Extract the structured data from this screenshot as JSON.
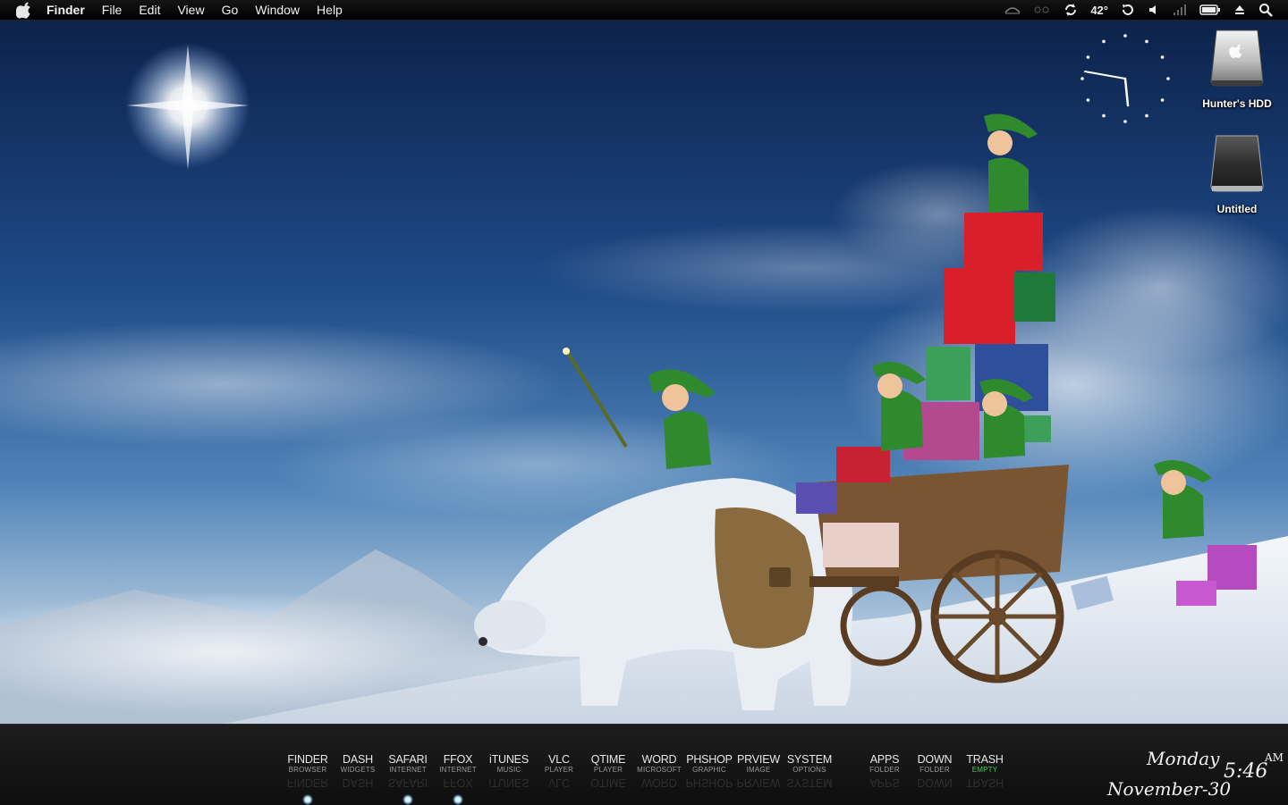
{
  "menubar": {
    "active_app": "Finder",
    "items": [
      "File",
      "Edit",
      "View",
      "Go",
      "Window",
      "Help"
    ],
    "status": {
      "temperature": "42°",
      "icons": [
        "network-icon",
        "bluetooth-icon",
        "sync-icon",
        "time-machine-icon",
        "volume-icon",
        "wifi-signal-icon",
        "battery-icon",
        "eject-icon",
        "spotlight-icon"
      ]
    }
  },
  "desktop": {
    "icons": [
      {
        "label": "Hunter's HDD",
        "icon": "hard-drive-icon"
      },
      {
        "label": "Untitled",
        "icon": "external-drive-icon"
      }
    ]
  },
  "dock": {
    "items": [
      {
        "title": "FINDER",
        "subtitle": "BROWSER",
        "running": true
      },
      {
        "title": "DASH",
        "subtitle": "WIDGETS",
        "running": false
      },
      {
        "title": "SAFARI",
        "subtitle": "INTERNET",
        "running": true
      },
      {
        "title": "FFOX",
        "subtitle": "INTERNET",
        "running": true
      },
      {
        "title": "iTUNES",
        "subtitle": "MUSIC",
        "running": false
      },
      {
        "title": "VLC",
        "subtitle": "PLAYER",
        "running": false
      },
      {
        "title": "QTIME",
        "subtitle": "PLAYER",
        "running": false
      },
      {
        "title": "WORD",
        "subtitle": "MICROSOFT",
        "running": false
      },
      {
        "title": "PHSHOP",
        "subtitle": "GRAPHIC",
        "running": false
      },
      {
        "title": "PRVIEW",
        "subtitle": "IMAGE",
        "running": false
      },
      {
        "title": "SYSTEM",
        "subtitle": "OPTIONS",
        "running": false
      }
    ],
    "folders": [
      {
        "title": "APPS",
        "subtitle": "FOLDER"
      },
      {
        "title": "DOWN",
        "subtitle": "FOLDER"
      },
      {
        "title": "TRASH",
        "subtitle": "EMPTY"
      }
    ],
    "trash_status_color": "#3fd24c"
  },
  "datetime": {
    "weekday": "Monday",
    "date": "November-30",
    "time": "5:46",
    "meridiem": "AM"
  }
}
